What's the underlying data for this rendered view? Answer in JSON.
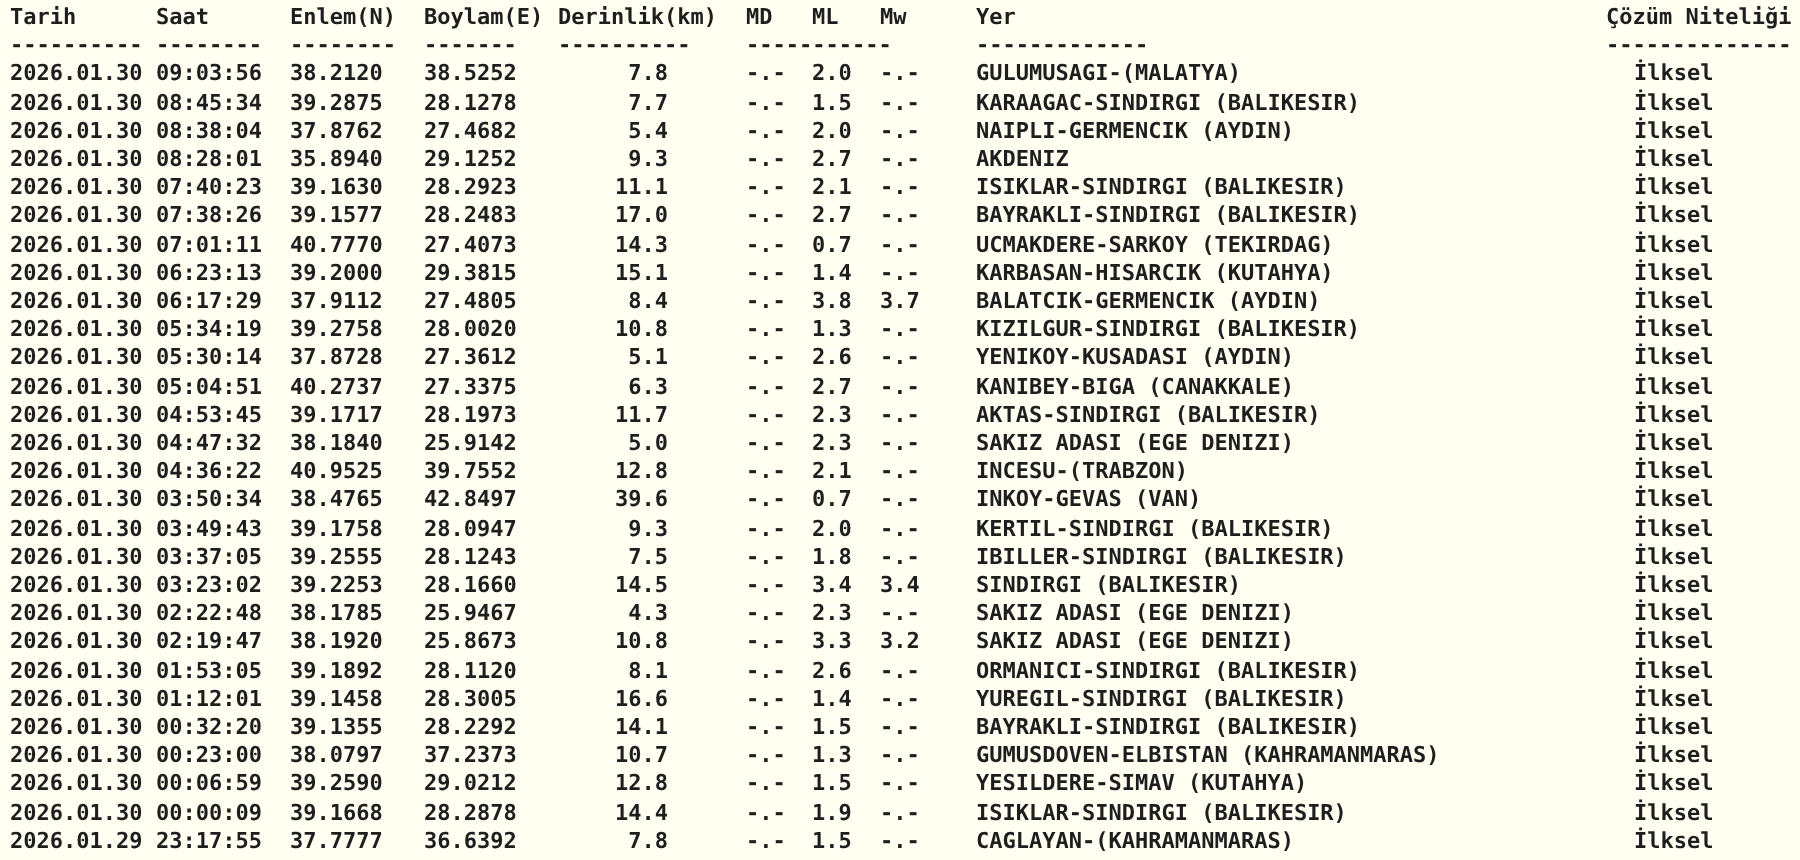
{
  "columns": [
    "Tarih",
    "Saat",
    "Enlem(N)",
    "Boylam(E)",
    "Derinlik(km)",
    "MD",
    "ML",
    "Mw",
    "Yer",
    "Çözüm Niteliği"
  ],
  "rules": [
    "----------",
    "--------",
    "--------",
    "-------",
    "----------",
    "-----------",
    "-------------",
    "--------------"
  ],
  "rows": [
    {
      "date": "2026.01.30",
      "time": "09:03:56",
      "lat": "38.2120",
      "lon": "38.5252",
      "depth": "7.8",
      "md": "-.-",
      "ml": "2.0",
      "mw": "-.-",
      "place": "GULUMUSAGI-(MALATYA)",
      "solution": "İlksel"
    },
    {
      "date": "2026.01.30",
      "time": "08:45:34",
      "lat": "39.2875",
      "lon": "28.1278",
      "depth": "7.7",
      "md": "-.-",
      "ml": "1.5",
      "mw": "-.-",
      "place": "KARAAGAC-SINDIRGI (BALIKESIR)",
      "solution": "İlksel"
    },
    {
      "date": "2026.01.30",
      "time": "08:38:04",
      "lat": "37.8762",
      "lon": "27.4682",
      "depth": "5.4",
      "md": "-.-",
      "ml": "2.0",
      "mw": "-.-",
      "place": "NAIPLI-GERMENCIK (AYDIN)",
      "solution": "İlksel"
    },
    {
      "date": "2026.01.30",
      "time": "08:28:01",
      "lat": "35.8940",
      "lon": "29.1252",
      "depth": "9.3",
      "md": "-.-",
      "ml": "2.7",
      "mw": "-.-",
      "place": "AKDENIZ",
      "solution": "İlksel"
    },
    {
      "date": "2026.01.30",
      "time": "07:40:23",
      "lat": "39.1630",
      "lon": "28.2923",
      "depth": "11.1",
      "md": "-.-",
      "ml": "2.1",
      "mw": "-.-",
      "place": "ISIKLAR-SINDIRGI (BALIKESIR)",
      "solution": "İlksel"
    },
    {
      "date": "2026.01.30",
      "time": "07:38:26",
      "lat": "39.1577",
      "lon": "28.2483",
      "depth": "17.0",
      "md": "-.-",
      "ml": "2.7",
      "mw": "-.-",
      "place": "BAYRAKLI-SINDIRGI (BALIKESIR)",
      "solution": "İlksel"
    },
    {
      "date": "2026.01.30",
      "time": "07:01:11",
      "lat": "40.7770",
      "lon": "27.4073",
      "depth": "14.3",
      "md": "-.-",
      "ml": "0.7",
      "mw": "-.-",
      "place": "UCMAKDERE-SARKOY (TEKIRDAG)",
      "solution": "İlksel"
    },
    {
      "date": "2026.01.30",
      "time": "06:23:13",
      "lat": "39.2000",
      "lon": "29.3815",
      "depth": "15.1",
      "md": "-.-",
      "ml": "1.4",
      "mw": "-.-",
      "place": "KARBASAN-HISARCIK (KUTAHYA)",
      "solution": "İlksel"
    },
    {
      "date": "2026.01.30",
      "time": "06:17:29",
      "lat": "37.9112",
      "lon": "27.4805",
      "depth": "8.4",
      "md": "-.-",
      "ml": "3.8",
      "mw": "3.7",
      "place": "BALATCIK-GERMENCIK (AYDIN)",
      "solution": "İlksel"
    },
    {
      "date": "2026.01.30",
      "time": "05:34:19",
      "lat": "39.2758",
      "lon": "28.0020",
      "depth": "10.8",
      "md": "-.-",
      "ml": "1.3",
      "mw": "-.-",
      "place": "KIZILGUR-SINDIRGI (BALIKESIR)",
      "solution": "İlksel"
    },
    {
      "date": "2026.01.30",
      "time": "05:30:14",
      "lat": "37.8728",
      "lon": "27.3612",
      "depth": "5.1",
      "md": "-.-",
      "ml": "2.6",
      "mw": "-.-",
      "place": "YENIKOY-KUSADASI (AYDIN)",
      "solution": "İlksel"
    },
    {
      "date": "2026.01.30",
      "time": "05:04:51",
      "lat": "40.2737",
      "lon": "27.3375",
      "depth": "6.3",
      "md": "-.-",
      "ml": "2.7",
      "mw": "-.-",
      "place": "KANIBEY-BIGA (CANAKKALE)",
      "solution": "İlksel"
    },
    {
      "date": "2026.01.30",
      "time": "04:53:45",
      "lat": "39.1717",
      "lon": "28.1973",
      "depth": "11.7",
      "md": "-.-",
      "ml": "2.3",
      "mw": "-.-",
      "place": "AKTAS-SINDIRGI (BALIKESIR)",
      "solution": "İlksel"
    },
    {
      "date": "2026.01.30",
      "time": "04:47:32",
      "lat": "38.1840",
      "lon": "25.9142",
      "depth": "5.0",
      "md": "-.-",
      "ml": "2.3",
      "mw": "-.-",
      "place": "SAKIZ ADASI (EGE DENIZI)",
      "solution": "İlksel"
    },
    {
      "date": "2026.01.30",
      "time": "04:36:22",
      "lat": "40.9525",
      "lon": "39.7552",
      "depth": "12.8",
      "md": "-.-",
      "ml": "2.1",
      "mw": "-.-",
      "place": "INCESU-(TRABZON)",
      "solution": "İlksel"
    },
    {
      "date": "2026.01.30",
      "time": "03:50:34",
      "lat": "38.4765",
      "lon": "42.8497",
      "depth": "39.6",
      "md": "-.-",
      "ml": "0.7",
      "mw": "-.-",
      "place": "INKOY-GEVAS (VAN)",
      "solution": "İlksel"
    },
    {
      "date": "2026.01.30",
      "time": "03:49:43",
      "lat": "39.1758",
      "lon": "28.0947",
      "depth": "9.3",
      "md": "-.-",
      "ml": "2.0",
      "mw": "-.-",
      "place": "KERTIL-SINDIRGI (BALIKESIR)",
      "solution": "İlksel"
    },
    {
      "date": "2026.01.30",
      "time": "03:37:05",
      "lat": "39.2555",
      "lon": "28.1243",
      "depth": "7.5",
      "md": "-.-",
      "ml": "1.8",
      "mw": "-.-",
      "place": "IBILLER-SINDIRGI (BALIKESIR)",
      "solution": "İlksel"
    },
    {
      "date": "2026.01.30",
      "time": "03:23:02",
      "lat": "39.2253",
      "lon": "28.1660",
      "depth": "14.5",
      "md": "-.-",
      "ml": "3.4",
      "mw": "3.4",
      "place": "SINDIRGI (BALIKESIR)",
      "solution": "İlksel"
    },
    {
      "date": "2026.01.30",
      "time": "02:22:48",
      "lat": "38.1785",
      "lon": "25.9467",
      "depth": "4.3",
      "md": "-.-",
      "ml": "2.3",
      "mw": "-.-",
      "place": "SAKIZ ADASI (EGE DENIZI)",
      "solution": "İlksel"
    },
    {
      "date": "2026.01.30",
      "time": "02:19:47",
      "lat": "38.1920",
      "lon": "25.8673",
      "depth": "10.8",
      "md": "-.-",
      "ml": "3.3",
      "mw": "3.2",
      "place": "SAKIZ ADASI (EGE DENIZI)",
      "solution": "İlksel"
    },
    {
      "date": "2026.01.30",
      "time": "01:53:05",
      "lat": "39.1892",
      "lon": "28.1120",
      "depth": "8.1",
      "md": "-.-",
      "ml": "2.6",
      "mw": "-.-",
      "place": "ORMANICI-SINDIRGI (BALIKESIR)",
      "solution": "İlksel"
    },
    {
      "date": "2026.01.30",
      "time": "01:12:01",
      "lat": "39.1458",
      "lon": "28.3005",
      "depth": "16.6",
      "md": "-.-",
      "ml": "1.4",
      "mw": "-.-",
      "place": "YUREGIL-SINDIRGI (BALIKESIR)",
      "solution": "İlksel"
    },
    {
      "date": "2026.01.30",
      "time": "00:32:20",
      "lat": "39.1355",
      "lon": "28.2292",
      "depth": "14.1",
      "md": "-.-",
      "ml": "1.5",
      "mw": "-.-",
      "place": "BAYRAKLI-SINDIRGI (BALIKESIR)",
      "solution": "İlksel"
    },
    {
      "date": "2026.01.30",
      "time": "00:23:00",
      "lat": "38.0797",
      "lon": "37.2373",
      "depth": "10.7",
      "md": "-.-",
      "ml": "1.3",
      "mw": "-.-",
      "place": "GUMUSDOVEN-ELBISTAN (KAHRAMANMARAS)",
      "solution": "İlksel"
    },
    {
      "date": "2026.01.30",
      "time": "00:06:59",
      "lat": "39.2590",
      "lon": "29.0212",
      "depth": "12.8",
      "md": "-.-",
      "ml": "1.5",
      "mw": "-.-",
      "place": "YESILDERE-SIMAV (KUTAHYA)",
      "solution": "İlksel"
    },
    {
      "date": "2026.01.30",
      "time": "00:00:09",
      "lat": "39.1668",
      "lon": "28.2878",
      "depth": "14.4",
      "md": "-.-",
      "ml": "1.9",
      "mw": "-.-",
      "place": "ISIKLAR-SINDIRGI (BALIKESIR)",
      "solution": "İlksel"
    },
    {
      "date": "2026.01.29",
      "time": "23:17:55",
      "lat": "37.7777",
      "lon": "36.6392",
      "depth": "7.8",
      "md": "-.-",
      "ml": "1.5",
      "mw": "-.-",
      "place": "CAGLAYAN-(KAHRAMANMARAS)",
      "solution": "İlksel"
    }
  ]
}
